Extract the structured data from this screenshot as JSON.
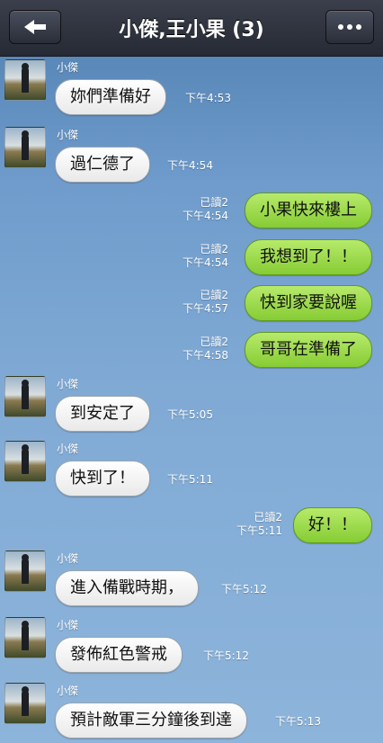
{
  "header": {
    "title": "小傑,王小果 (3)",
    "back_icon": "back-arrow-icon",
    "more_icon": "more-dots-icon"
  },
  "messages": [
    {
      "sender": "小傑",
      "text": "妳們準備好",
      "time": "下午4:53"
    },
    {
      "sender": "小傑",
      "text": "過仁德了",
      "time": "下午4:54"
    },
    {
      "read": "已讀2",
      "time": "下午4:54",
      "text": "小果快來樓上"
    },
    {
      "read": "已讀2",
      "time": "下午4:54",
      "text": "我想到了！！"
    },
    {
      "read": "已讀2",
      "time": "下午4:57",
      "text": "快到家要說喔"
    },
    {
      "read": "已讀2",
      "time": "下午4:58",
      "text": "哥哥在準備了"
    },
    {
      "sender": "小傑",
      "text": "到安定了",
      "time": "下午5:05"
    },
    {
      "sender": "小傑",
      "text": "快到了！",
      "time": "下午5:11"
    },
    {
      "read": "已讀2",
      "time": "下午5:11",
      "text": "好！！"
    },
    {
      "sender": "小傑",
      "text": "進入備戰時期，",
      "time": "下午5:12"
    },
    {
      "sender": "小傑",
      "text": "發佈紅色警戒",
      "time": "下午5:12"
    },
    {
      "sender": "小傑",
      "text": "預計敵軍三分鐘後到達",
      "time": "下午5:13"
    }
  ]
}
